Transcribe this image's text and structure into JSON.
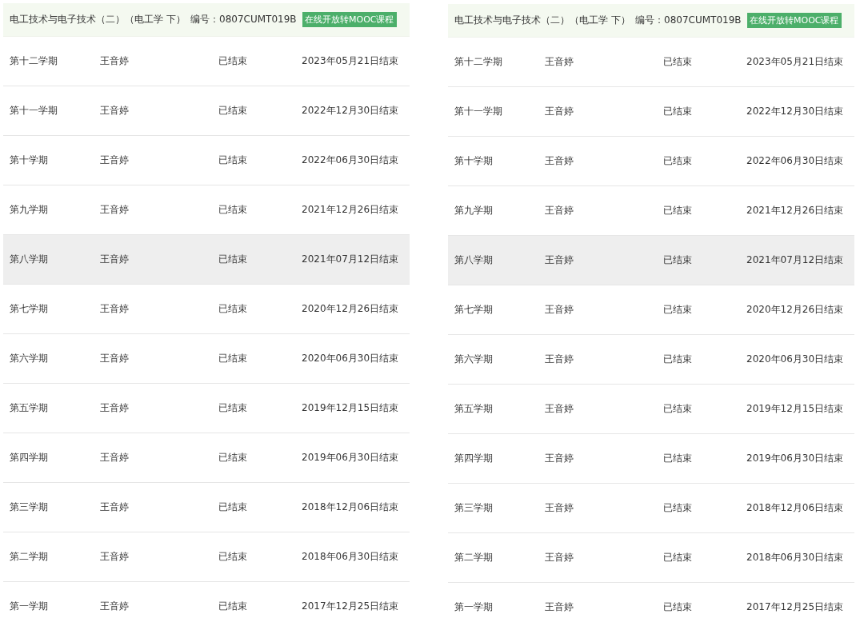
{
  "panels": [
    {
      "course": {
        "title": "电工技术与电子技术（二）（电工学 下）",
        "code": "编号：0807CUMT019B",
        "badge": "在线开放转MOOC课程"
      },
      "rows": [
        {
          "term": "第十二学期",
          "teacher": "王音婷",
          "status": "已结束",
          "end": "2023年05月21日结束",
          "highlighted": false
        },
        {
          "term": "第十一学期",
          "teacher": "王音婷",
          "status": "已结束",
          "end": "2022年12月30日结束",
          "highlighted": false
        },
        {
          "term": "第十学期",
          "teacher": "王音婷",
          "status": "已结束",
          "end": "2022年06月30日结束",
          "highlighted": false
        },
        {
          "term": "第九学期",
          "teacher": "王音婷",
          "status": "已结束",
          "end": "2021年12月26日结束",
          "highlighted": false
        },
        {
          "term": "第八学期",
          "teacher": "王音婷",
          "status": "已结束",
          "end": "2021年07月12日结束",
          "highlighted": true
        },
        {
          "term": "第七学期",
          "teacher": "王音婷",
          "status": "已结束",
          "end": "2020年12月26日结束",
          "highlighted": false
        },
        {
          "term": "第六学期",
          "teacher": "王音婷",
          "status": "已结束",
          "end": "2020年06月30日结束",
          "highlighted": false
        },
        {
          "term": "第五学期",
          "teacher": "王音婷",
          "status": "已结束",
          "end": "2019年12月15日结束",
          "highlighted": false
        },
        {
          "term": "第四学期",
          "teacher": "王音婷",
          "status": "已结束",
          "end": "2019年06月30日结束",
          "highlighted": false
        },
        {
          "term": "第三学期",
          "teacher": "王音婷",
          "status": "已结束",
          "end": "2018年12月06日结束",
          "highlighted": false
        },
        {
          "term": "第二学期",
          "teacher": "王音婷",
          "status": "已结束",
          "end": "2018年06月30日结束",
          "highlighted": false
        },
        {
          "term": "第一学期",
          "teacher": "王音婷",
          "status": "已结束",
          "end": "2017年12月25日结束",
          "highlighted": false
        }
      ]
    },
    {
      "course": {
        "title": "电工技术与电子技术（二）（电工学 下）",
        "code": "编号：0807CUMT019B",
        "badge": "在线开放转MOOC课程"
      },
      "rows": [
        {
          "term": "第十二学期",
          "teacher": "王音婷",
          "status": "已结束",
          "end": "2023年05月21日结束",
          "highlighted": false
        },
        {
          "term": "第十一学期",
          "teacher": "王音婷",
          "status": "已结束",
          "end": "2022年12月30日结束",
          "highlighted": false
        },
        {
          "term": "第十学期",
          "teacher": "王音婷",
          "status": "已结束",
          "end": "2022年06月30日结束",
          "highlighted": false
        },
        {
          "term": "第九学期",
          "teacher": "王音婷",
          "status": "已结束",
          "end": "2021年12月26日结束",
          "highlighted": false
        },
        {
          "term": "第八学期",
          "teacher": "王音婷",
          "status": "已结束",
          "end": "2021年07月12日结束",
          "highlighted": true
        },
        {
          "term": "第七学期",
          "teacher": "王音婷",
          "status": "已结束",
          "end": "2020年12月26日结束",
          "highlighted": false
        },
        {
          "term": "第六学期",
          "teacher": "王音婷",
          "status": "已结束",
          "end": "2020年06月30日结束",
          "highlighted": false
        },
        {
          "term": "第五学期",
          "teacher": "王音婷",
          "status": "已结束",
          "end": "2019年12月15日结束",
          "highlighted": false
        },
        {
          "term": "第四学期",
          "teacher": "王音婷",
          "status": "已结束",
          "end": "2019年06月30日结束",
          "highlighted": false
        },
        {
          "term": "第三学期",
          "teacher": "王音婷",
          "status": "已结束",
          "end": "2018年12月06日结束",
          "highlighted": false
        },
        {
          "term": "第二学期",
          "teacher": "王音婷",
          "status": "已结束",
          "end": "2018年06月30日结束",
          "highlighted": false
        },
        {
          "term": "第一学期",
          "teacher": "王音婷",
          "status": "已结束",
          "end": "2017年12月25日结束",
          "highlighted": false
        }
      ]
    }
  ]
}
